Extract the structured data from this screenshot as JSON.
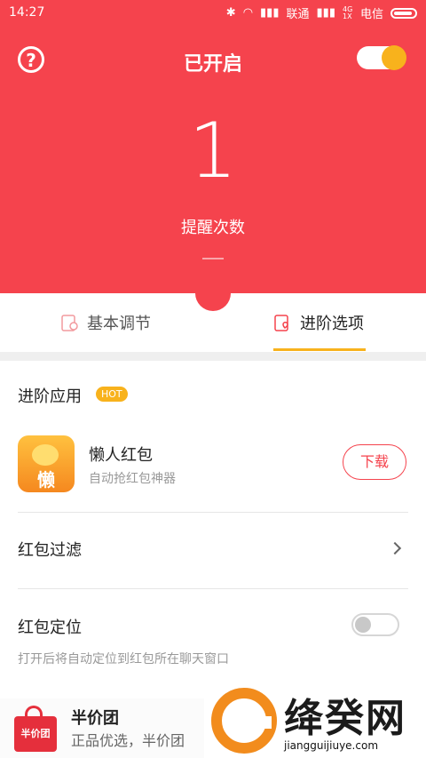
{
  "status_bar": {
    "time": "14:27",
    "carrier1": "联通",
    "carrier2": "电信",
    "network_badge": "4G 1X"
  },
  "header": {
    "title": "已开启",
    "toggle_on": true,
    "help_symbol": "?"
  },
  "counter": {
    "value": "1",
    "label": "提醒次数"
  },
  "tabs": [
    {
      "label": "基本调节",
      "icon": "settings-envelope-icon",
      "active": false
    },
    {
      "label": "进阶选项",
      "icon": "heart-envelope-icon",
      "active": true
    }
  ],
  "advanced": {
    "section_title": "进阶应用",
    "hot_badge": "HOT",
    "app": {
      "icon_glyph": "懒",
      "name": "懒人红包",
      "description": "自动抢红包神器",
      "button_label": "下载"
    },
    "filter_label": "红包过滤",
    "locate_label": "红包定位",
    "locate_toggle_on": false,
    "locate_description": "打开后将自动定位到红包所在聊天窗口"
  },
  "promo": {
    "icon_text": "半价团",
    "title": "半价团",
    "subtitle": "正品优选，半价团"
  },
  "watermark": {
    "title": "绛癸网",
    "url": "jiangguijiuye.com"
  },
  "colors": {
    "primary_red": "#f5434d",
    "accent_yellow": "#f8b21c"
  }
}
